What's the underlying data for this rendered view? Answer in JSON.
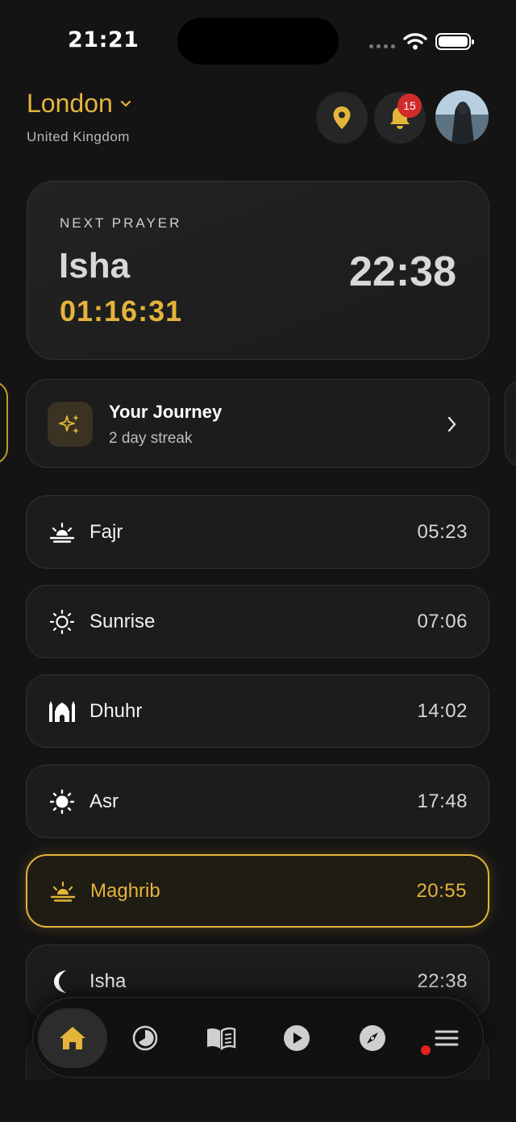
{
  "status_bar": {
    "time": "21:21"
  },
  "header": {
    "city": "London",
    "country": "United Kingdom",
    "notification_count": "15"
  },
  "next_prayer": {
    "label": "NEXT PRAYER",
    "name": "Isha",
    "countdown": "01:16:31",
    "time": "22:38"
  },
  "journey": {
    "title": "Your Journey",
    "subtitle": "2 day streak"
  },
  "prayers": [
    {
      "name": "Fajr",
      "time": "05:23",
      "icon": "sunrise-icon"
    },
    {
      "name": "Sunrise",
      "time": "07:06",
      "icon": "sun-outline-icon"
    },
    {
      "name": "Dhuhr",
      "time": "14:02",
      "icon": "mosque-icon"
    },
    {
      "name": "Asr",
      "time": "17:48",
      "icon": "sun-icon"
    },
    {
      "name": "Maghrib",
      "time": "20:55",
      "icon": "sunset-icon",
      "active": true
    },
    {
      "name": "Isha",
      "time": "22:38",
      "icon": "moon-icon"
    }
  ],
  "nav": {
    "tabs": [
      "home-icon",
      "clock-icon",
      "book-icon",
      "play-icon",
      "compass-icon",
      "menu-icon"
    ],
    "active": "home-icon"
  },
  "colors": {
    "accent": "#e4b43b",
    "background": "#141414",
    "card": "#1c1c1c",
    "alert": "#d12b2b"
  }
}
